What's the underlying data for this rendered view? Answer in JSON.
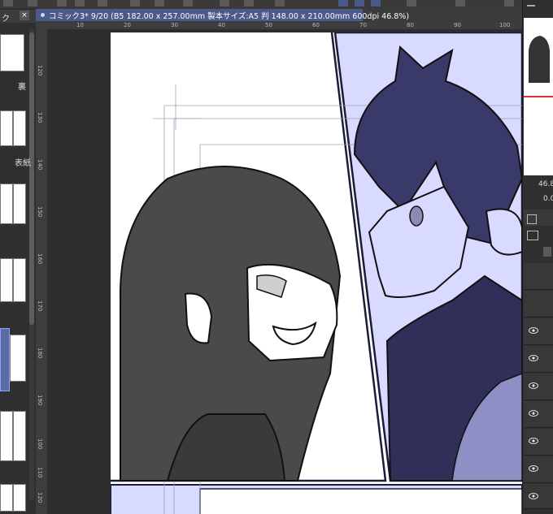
{
  "app": {
    "left_panel_tab": "ク",
    "left_panel_close": "×"
  },
  "document": {
    "tab_title": "コミック3* 9/20 (B5 182.00 x 257.00mm 製本サイズ:A5 判 148.00 x 210.00mm 600dpi 46.8%)"
  },
  "pages_panel": {
    "labels": [
      "裏",
      "表紙"
    ]
  },
  "ruler": {
    "top_ticks": [
      "10",
      "20",
      "30",
      "40",
      "50",
      "60",
      "70",
      "80",
      "90",
      "100"
    ],
    "left_ticks": [
      "120",
      "130",
      "140",
      "150",
      "160",
      "170",
      "180",
      "190",
      "100",
      "110",
      "120"
    ]
  },
  "navigator": {
    "zoom": "46.8",
    "angle": "0.0"
  },
  "colors": {
    "panel_tint": "#d9daff",
    "ink": "#1c1c3a",
    "tab_active": "#4b5a8a"
  }
}
